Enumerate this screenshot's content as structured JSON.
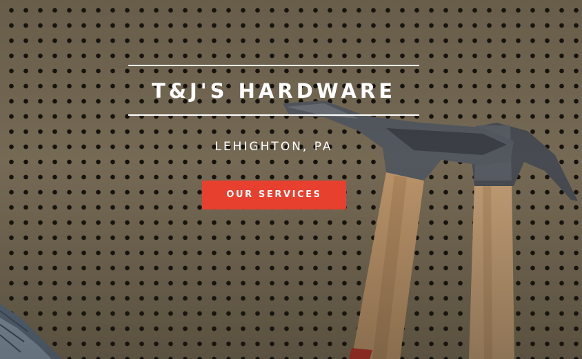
{
  "hero": {
    "title": "T&J'S HARDWARE",
    "subtitle": "LEHIGHTON, PA",
    "cta_label": "OUR SERVICES",
    "background": "pegboard-with-hammers-photo"
  },
  "colors": {
    "accent": "#e8402f",
    "text": "#ffffff",
    "pegboard": "#7a6e58"
  }
}
